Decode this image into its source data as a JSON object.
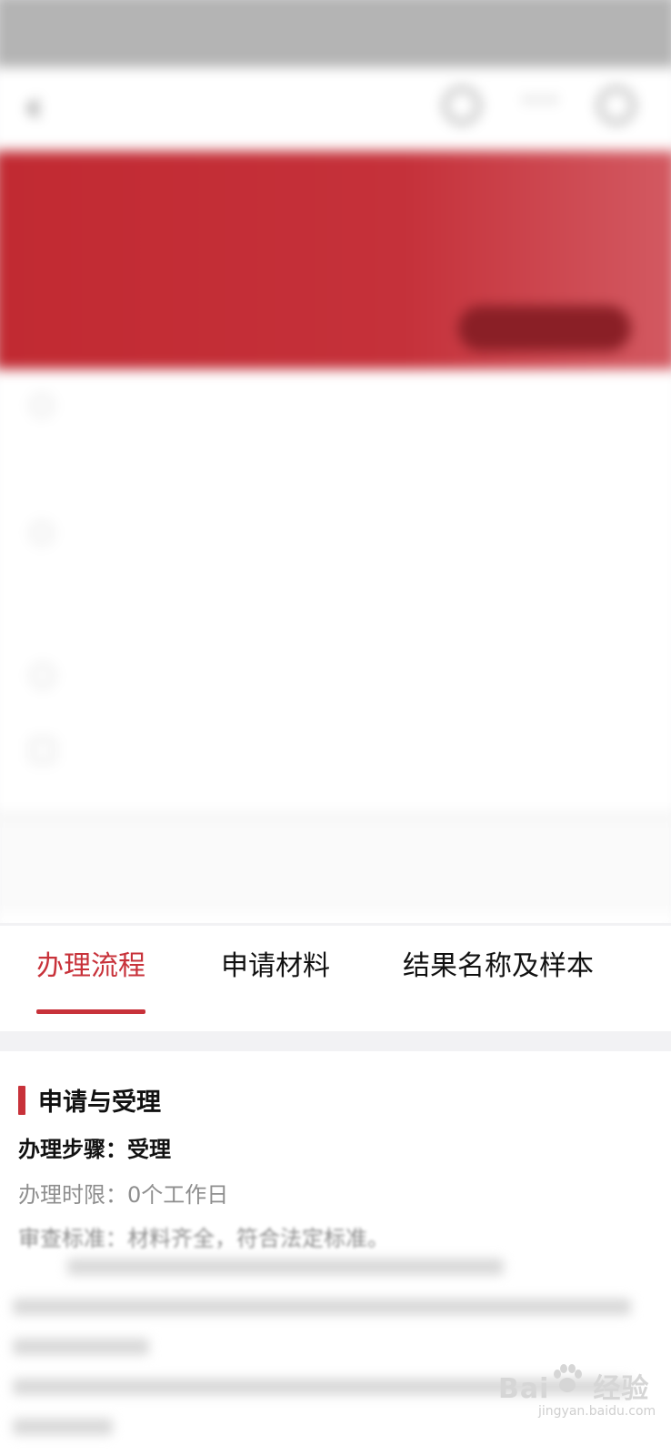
{
  "status_bar": {
    "left_text": "",
    "right_text": ""
  },
  "nav": {
    "title": "",
    "icons": [
      "back-icon",
      "star-icon",
      "more-icon",
      "close-icon"
    ]
  },
  "banner": {
    "title": "",
    "subtitle": "",
    "button_label": ""
  },
  "tabs": [
    {
      "label": "办理流程",
      "active": true
    },
    {
      "label": "申请材料",
      "active": false
    },
    {
      "label": "结果名称及样本",
      "active": false
    }
  ],
  "section": {
    "title": "申请与受理",
    "step": "办理步骤：受理",
    "time_limit": "办理时限：0个工作日",
    "standard": "审查标准：材料齐全，符合法定标准。"
  },
  "watermark": {
    "logo": "Bai",
    "logo_tail": "经验",
    "url": "jingyan.baidu.com"
  },
  "colors": {
    "accent": "#c8323a",
    "link": "#4f55e0",
    "muted_text": "#8e8e8e"
  }
}
